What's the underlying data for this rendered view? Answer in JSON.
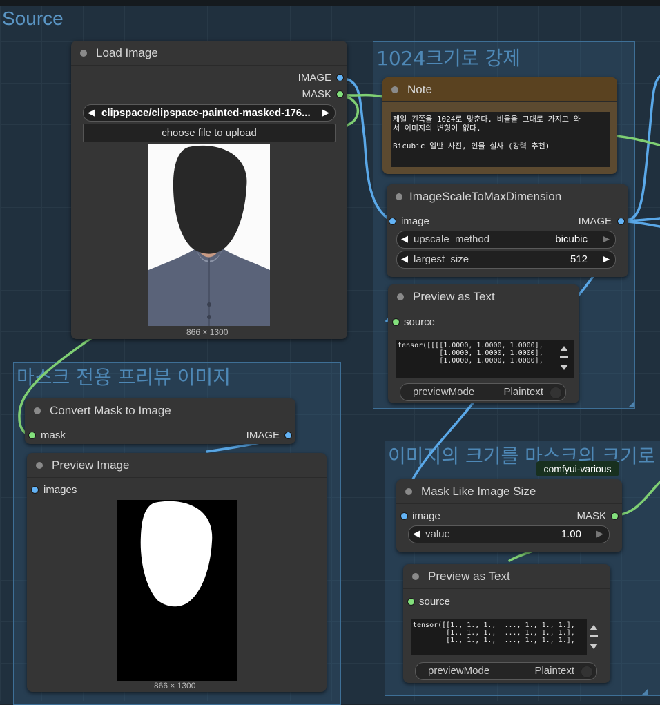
{
  "groups": {
    "source": "Source",
    "resize": "1024크기로 강제",
    "mask_preview": "마스크 전용 프리뷰 이미지",
    "mask_size": "이미지의 크기를 마스크의 크기로"
  },
  "load_image": {
    "title": "Load Image",
    "out_image": "IMAGE",
    "out_mask": "MASK",
    "image_value": "clipspace/clipspace-painted-masked-176...",
    "upload_label": "choose file to upload",
    "size": "866 × 1300"
  },
  "note": {
    "title": "Note",
    "line1": "제일 긴쪽을 1024로 맞춘다. 비율을 그대로 가지고 와",
    "line2": "서 이미지의 변형이 없다.",
    "line3": "Bicubic 일반 사진, 인물 실사 (강력 추천)"
  },
  "scale": {
    "title": "ImageScaleToMaxDimension",
    "in_image": "image",
    "out_image": "IMAGE",
    "method_label": "upscale_method",
    "method_value": "bicubic",
    "size_label": "largest_size",
    "size_value": "512"
  },
  "preview_text_1": {
    "title": "Preview as Text",
    "in_source": "source",
    "text": "tensor([[[[1.0000, 1.0000, 1.0000],\n          [1.0000, 1.0000, 1.0000],\n          [1.0000, 1.0000, 1.0000],",
    "mode_label": "previewMode",
    "mode_value": "Plaintext"
  },
  "convert": {
    "title": "Convert Mask to Image",
    "in_mask": "mask",
    "out_image": "IMAGE"
  },
  "preview_image": {
    "title": "Preview Image",
    "in_images": "images",
    "size": "866 × 1300"
  },
  "badge": "comfyui-various",
  "mask_like": {
    "title": "Mask Like Image Size",
    "in_image": "image",
    "out_mask": "MASK",
    "value_label": "value",
    "value": "1.00"
  },
  "preview_text_2": {
    "title": "Preview as Text",
    "in_source": "source",
    "text": "tensor([[1., 1., 1.,  ..., 1., 1., 1.],\n        [1., 1., 1.,  ..., 1., 1., 1.],\n        [1., 1., 1.,  ..., 1., 1., 1.],",
    "mode_label": "previewMode",
    "mode_value": "Plaintext"
  },
  "colors": {
    "canvas": "#1c2730",
    "group": "#3e6f96",
    "node": "#353535",
    "note_header": "#5a4220",
    "image_link": "#63b3f6",
    "mask_link": "#83e07c"
  }
}
